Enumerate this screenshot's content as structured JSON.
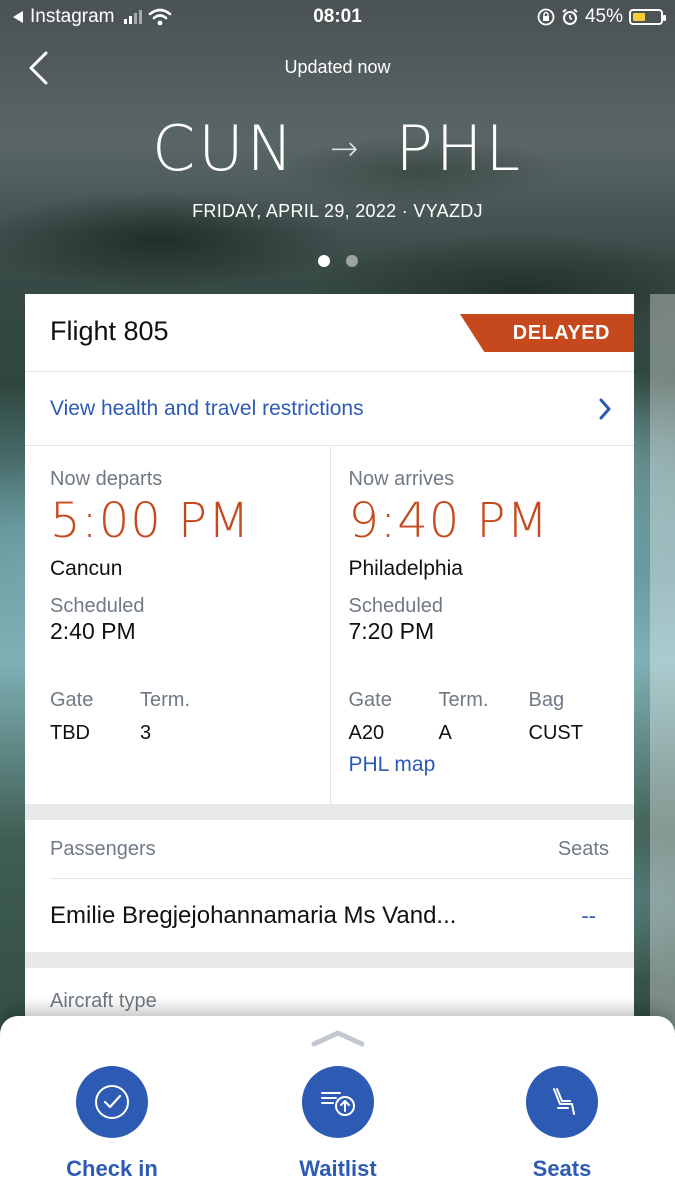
{
  "status_bar": {
    "back_app": "Instagram",
    "time": "08:01",
    "battery": "45%",
    "battery_level": 0.45
  },
  "header": {
    "updated": "Updated now",
    "origin": "CUN",
    "destination": "PHL",
    "date_line": "FRIDAY, APRIL 29, 2022 · VYAZDJ",
    "page_count": 2,
    "active_page": 0
  },
  "flight": {
    "title": "Flight 805",
    "status": "DELAYED",
    "status_color": "#c5491d",
    "restrictions_link": "View health and travel restrictions"
  },
  "departure": {
    "label": "Now departs",
    "time": "5:00 PM",
    "city": "Cancun",
    "scheduled_label": "Scheduled",
    "scheduled_time": "2:40 PM",
    "gate_label": "Gate",
    "gate": "TBD",
    "term_label": "Term.",
    "term": "3"
  },
  "arrival": {
    "label": "Now arrives",
    "time": "9:40 PM",
    "city": "Philadelphia",
    "scheduled_label": "Scheduled",
    "scheduled_time": "7:20 PM",
    "gate_label": "Gate",
    "gate": "A20",
    "term_label": "Term.",
    "term": "A",
    "bag_label": "Bag",
    "bag": "CUST",
    "map_link": "PHL map"
  },
  "passengers": {
    "header": "Passengers",
    "seats_header": "Seats",
    "list": [
      {
        "name": "Emilie Bregjejohannamaria Ms Vand...",
        "seat": "--"
      }
    ]
  },
  "aircraft": {
    "label": "Aircraft type"
  },
  "actions": {
    "check_in": "Check in",
    "waitlist": "Waitlist",
    "seats": "Seats"
  },
  "colors": {
    "accent_blue": "#2d5bb3",
    "accent_orange": "#c5491d"
  },
  "icons": [
    "back-chevron-icon",
    "wifi-icon",
    "lock-icon",
    "alarm-icon",
    "chevron-right-icon",
    "checkmark-icon",
    "waitlist-icon",
    "seat-icon",
    "sheet-handle-icon"
  ]
}
